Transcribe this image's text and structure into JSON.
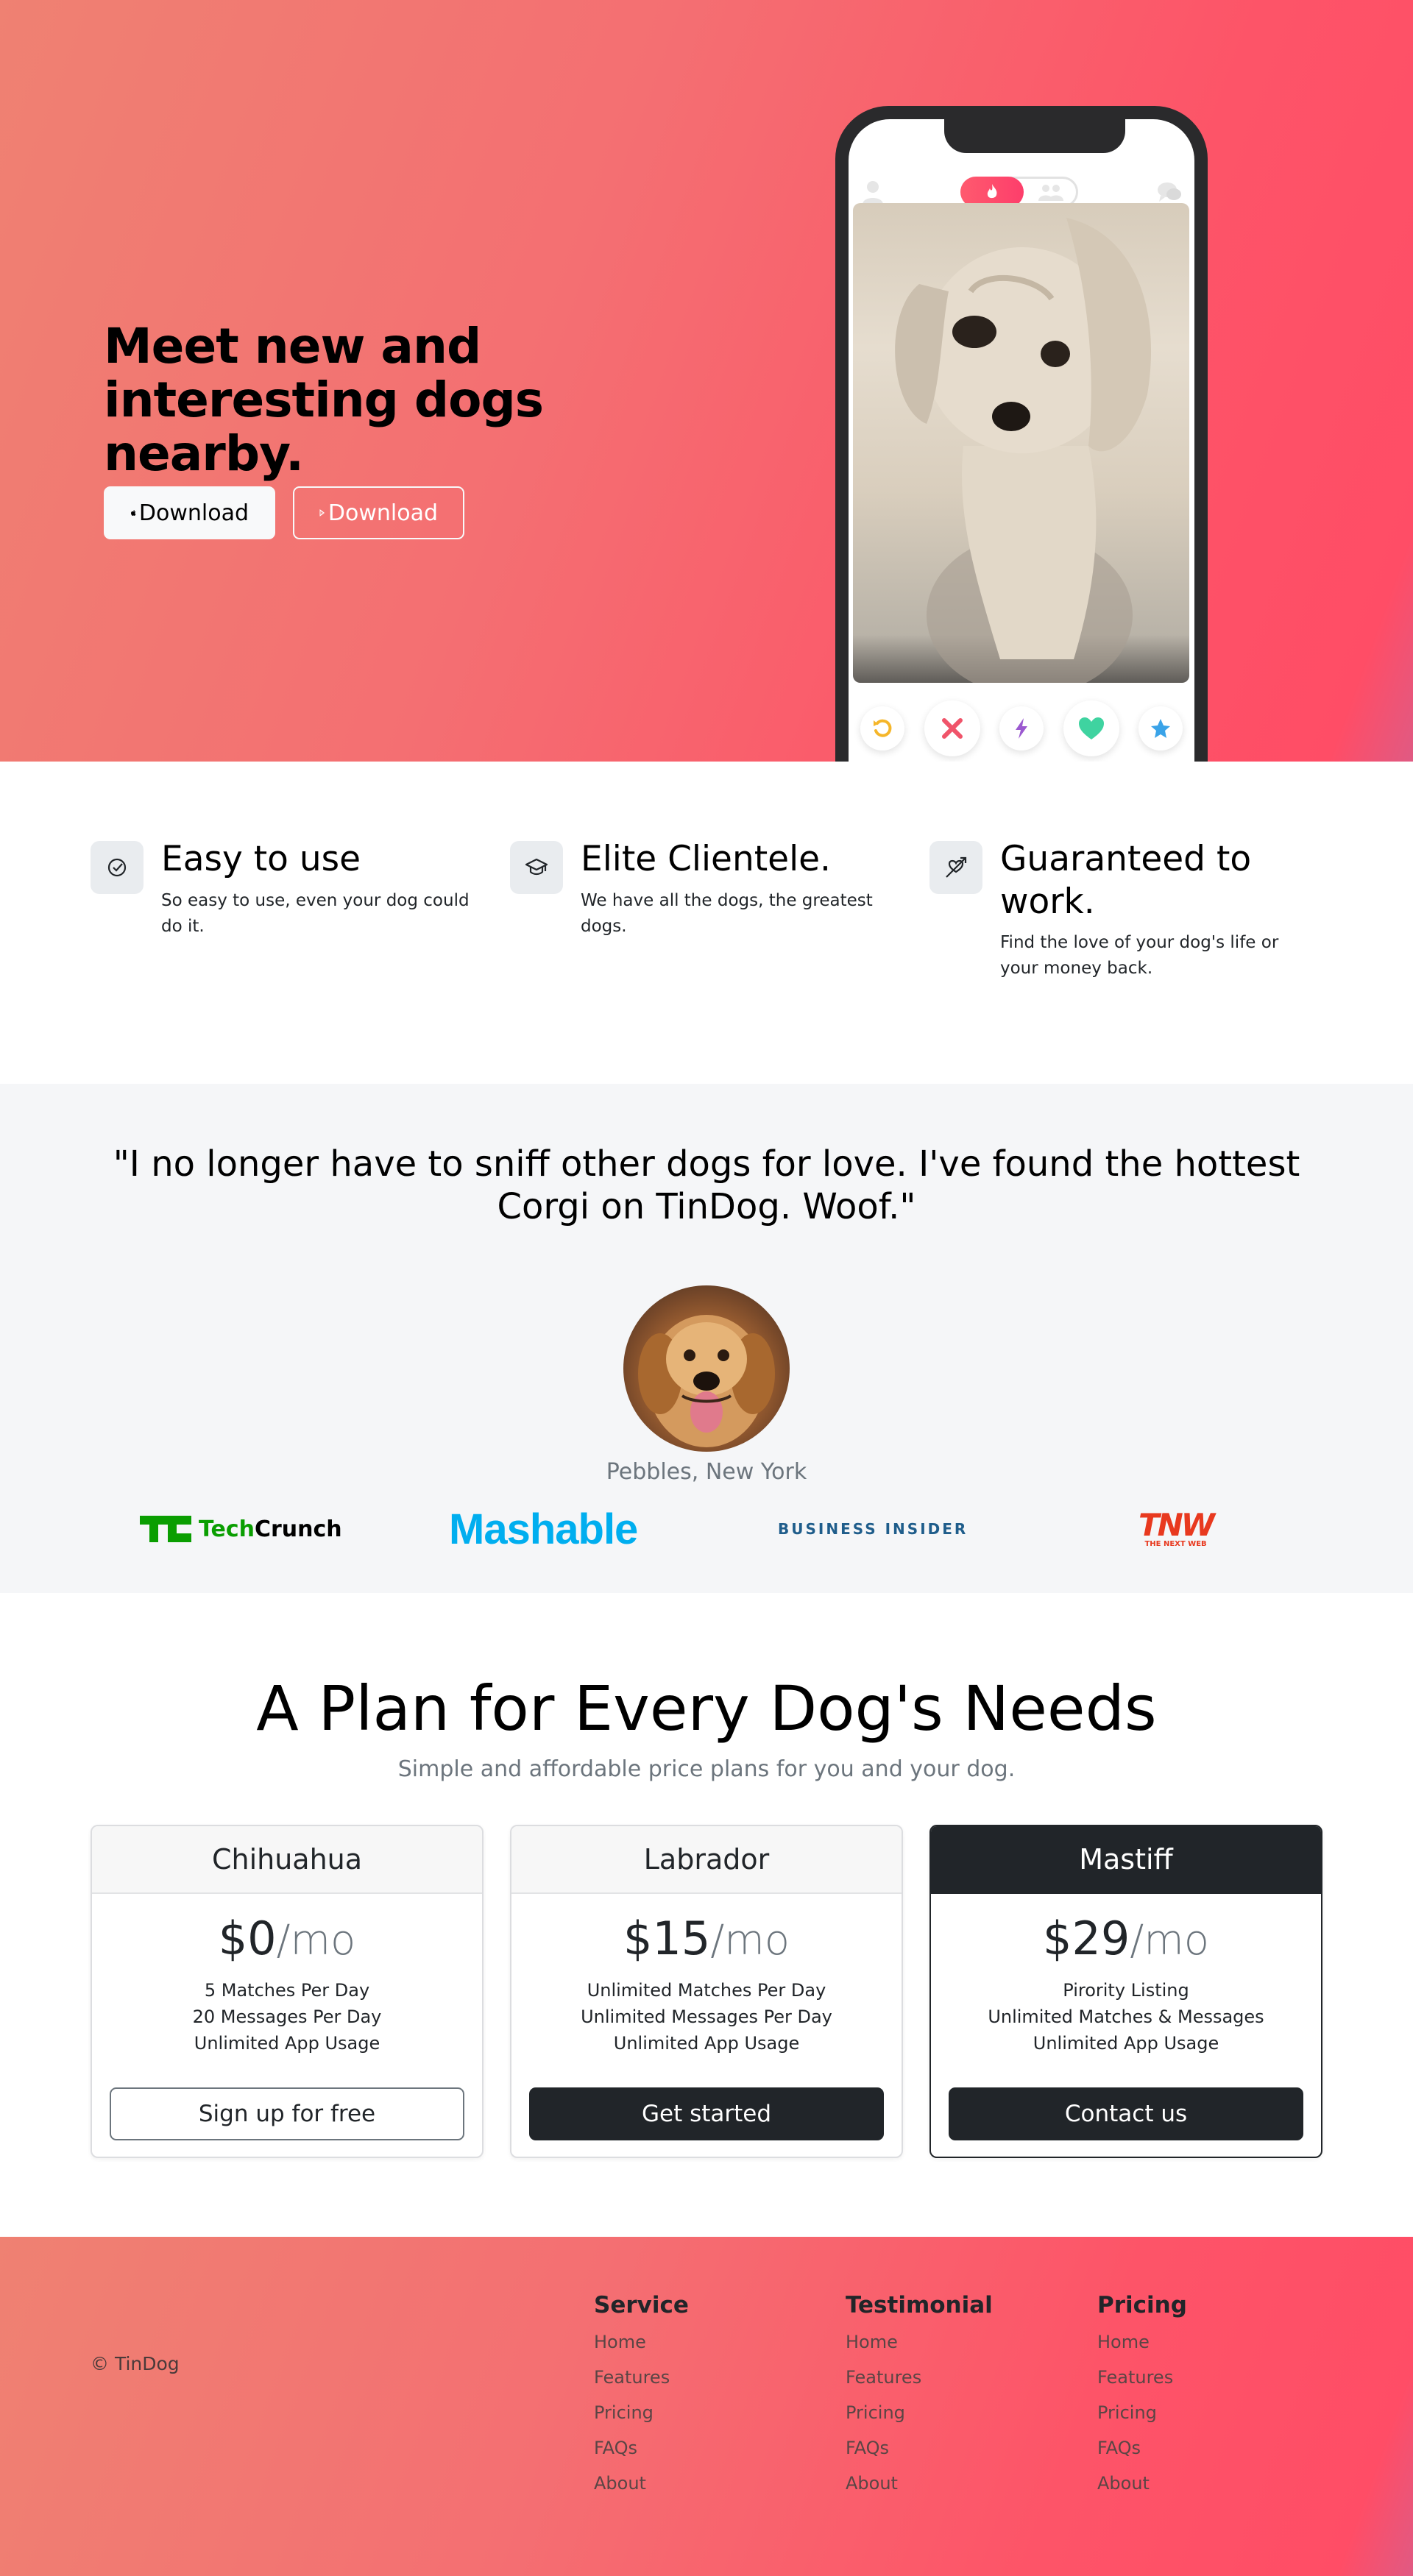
{
  "hero": {
    "title": "Meet new and interesting dogs nearby.",
    "download_apple": "Download",
    "download_play": "Download"
  },
  "features": [
    {
      "title": "Easy to use",
      "desc": "So easy to use, even your dog could do it.",
      "icon": "check-circle-icon"
    },
    {
      "title": "Elite Clientele.",
      "desc": "We have all the dogs, the greatest dogs.",
      "icon": "graduation-cap-icon"
    },
    {
      "title": "Guaranteed to work.",
      "desc": "Find the love of your dog's life or your money back.",
      "icon": "heart-arrow-icon"
    }
  ],
  "testimonial": {
    "quote": "\"I no longer have to sniff other dogs for love. I've found the hottest Corgi on TinDog. Woof.\"",
    "author": "Pebbles, New York"
  },
  "press": {
    "techcrunch": "TechCrunch",
    "mashable": "Mashable",
    "business_insider": "BUSINESS INSIDER",
    "tnw": "TNW",
    "tnw_sub": "THE NEXT WEB"
  },
  "pricing": {
    "title": "A Plan for Every Dog's Needs",
    "subtitle": "Simple and affordable price plans for you and your dog.",
    "plans": [
      {
        "name": "Chihuahua",
        "price": "$0",
        "per": "/mo",
        "features": [
          "5 Matches Per Day",
          "20 Messages Per Day",
          "Unlimited App Usage"
        ],
        "cta": "Sign up for free"
      },
      {
        "name": "Labrador",
        "price": "$15",
        "per": "/mo",
        "features": [
          "Unlimited Matches Per Day",
          "Unlimited Messages Per Day",
          "Unlimited App Usage"
        ],
        "cta": "Get started"
      },
      {
        "name": "Mastiff",
        "price": "$29",
        "per": "/mo",
        "features": [
          "Pirority Listing",
          "Unlimited Matches & Messages",
          "Unlimited App Usage"
        ],
        "cta": "Contact us"
      }
    ]
  },
  "footer": {
    "copyright": "© TinDog",
    "columns": [
      {
        "heading": "Service",
        "links": [
          "Home",
          "Features",
          "Pricing",
          "FAQs",
          "About"
        ]
      },
      {
        "heading": "Testimonial",
        "links": [
          "Home",
          "Features",
          "Pricing",
          "FAQs",
          "About"
        ]
      },
      {
        "heading": "Pricing",
        "links": [
          "Home",
          "Features",
          "Pricing",
          "FAQs",
          "About"
        ]
      }
    ]
  },
  "colors": {
    "brand_gradient_start": "#ef8172",
    "brand_gradient_end": "#ff4d66",
    "dark": "#212529",
    "techcrunch_green": "#0a9e01",
    "mashable_blue": "#00aeef",
    "tnw_red": "#e8391f"
  }
}
